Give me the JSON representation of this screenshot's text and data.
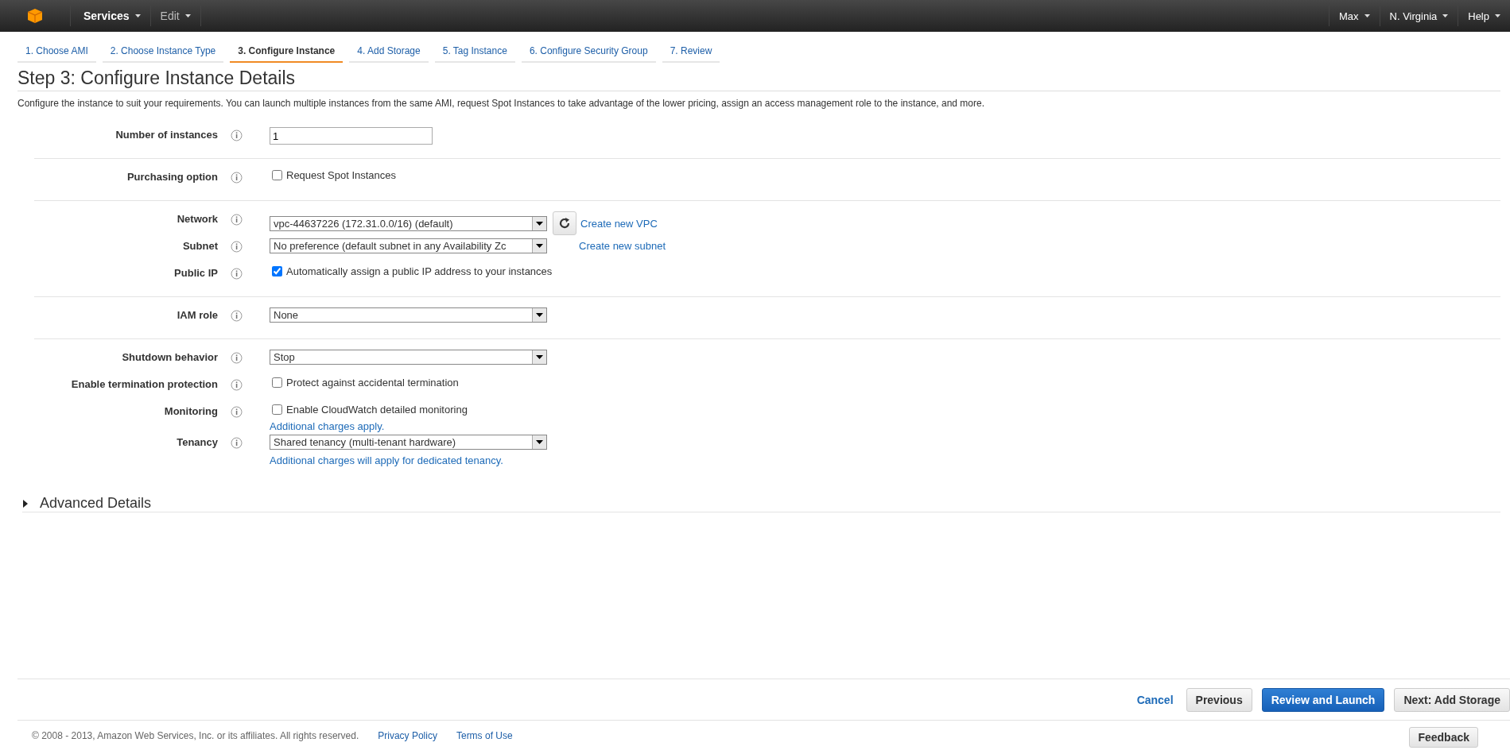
{
  "top_nav": {
    "left": [
      {
        "label": "Services",
        "bold": true
      },
      {
        "label": "Edit",
        "bold": false
      }
    ],
    "right": [
      {
        "label": "Max"
      },
      {
        "label": "N. Virginia"
      },
      {
        "label": "Help"
      }
    ]
  },
  "steps": [
    {
      "label": "1. Choose AMI",
      "selected": false
    },
    {
      "label": "2. Choose Instance Type",
      "selected": false
    },
    {
      "label": "3. Configure Instance",
      "selected": true
    },
    {
      "label": "4. Add Storage",
      "selected": false
    },
    {
      "label": "5. Tag Instance",
      "selected": false
    },
    {
      "label": "6. Configure Security Group",
      "selected": false
    },
    {
      "label": "7. Review",
      "selected": false
    }
  ],
  "title": "Step 3: Configure Instance Details",
  "description": "Configure the instance to suit your requirements. You can launch multiple instances from the same AMI, request Spot Instances to take advantage of the lower pricing, assign an access management role to the instance, and more.",
  "sections": [
    {
      "fields": [
        {
          "label": "Number of instances",
          "kind": "text",
          "value": "1"
        }
      ]
    },
    {
      "fields": [
        {
          "label": "Purchasing option",
          "kind": "checkbox",
          "text": "Request Spot Instances",
          "checked": false
        }
      ]
    },
    {
      "fields": [
        {
          "label": "Network",
          "kind": "select",
          "value": "vpc-44637226 (172.31.0.0/16) (default)",
          "refresh": true,
          "link": "Create new VPC"
        },
        {
          "label": "Subnet",
          "kind": "select",
          "value": "No preference (default subnet in any Availability Zc",
          "refresh": false,
          "link": "Create new subnet"
        },
        {
          "label": "Public IP",
          "kind": "checkbox",
          "text": "Automatically assign a public IP address to your instances",
          "checked": true
        }
      ]
    },
    {
      "fields": [
        {
          "label": "IAM role",
          "kind": "select",
          "value": "None"
        }
      ]
    },
    {
      "fields": [
        {
          "label": "Shutdown behavior",
          "kind": "select",
          "value": "Stop"
        },
        {
          "label": "Enable termination protection",
          "kind": "checkbox",
          "text": "Protect against accidental termination",
          "checked": false
        },
        {
          "label": "Monitoring",
          "kind": "checkbox",
          "text": "Enable CloudWatch detailed monitoring",
          "checked": false,
          "note": "Additional charges apply."
        },
        {
          "label": "Tenancy",
          "kind": "select",
          "value": "Shared tenancy (multi-tenant hardware)",
          "note": "Additional charges will apply for dedicated tenancy."
        }
      ]
    }
  ],
  "advanced": {
    "label": "Advanced Details",
    "expanded": false
  },
  "actions": [
    {
      "label": "Cancel",
      "kind": "link"
    },
    {
      "label": "Previous",
      "kind": "secondary"
    },
    {
      "label": "Review and Launch",
      "kind": "primary"
    },
    {
      "label": "Next: Add Storage",
      "kind": "secondary"
    }
  ],
  "footer": {
    "copyright": "© 2008 - 2013, Amazon Web Services, Inc. or its affiliates. All rights reserved.",
    "links": [
      "Privacy Policy",
      "Terms of Use"
    ],
    "feedback": "Feedback"
  }
}
